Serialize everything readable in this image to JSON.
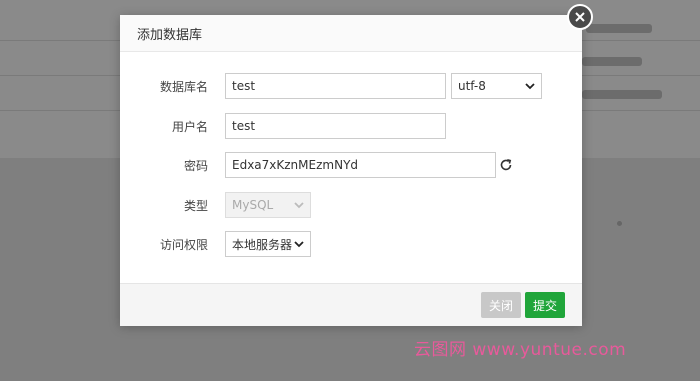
{
  "dialog": {
    "title": "添加数据库"
  },
  "form": {
    "db_name_label": "数据库名",
    "db_name_value": "test",
    "charset_value": "utf-8",
    "username_label": "用户名",
    "username_value": "test",
    "password_label": "密码",
    "password_value": "Edxa7xKznMEzmNYd",
    "type_label": "类型",
    "type_value": "MySQL",
    "access_label": "访问权限",
    "access_value": "本地服务器"
  },
  "footer": {
    "close_label": "关闭",
    "submit_label": "提交"
  },
  "watermark": {
    "text": "云图网 www.yuntue.com"
  },
  "colors": {
    "submit": "#20a53a",
    "close": "#c8c8c8",
    "watermark": "#e85a9b"
  }
}
